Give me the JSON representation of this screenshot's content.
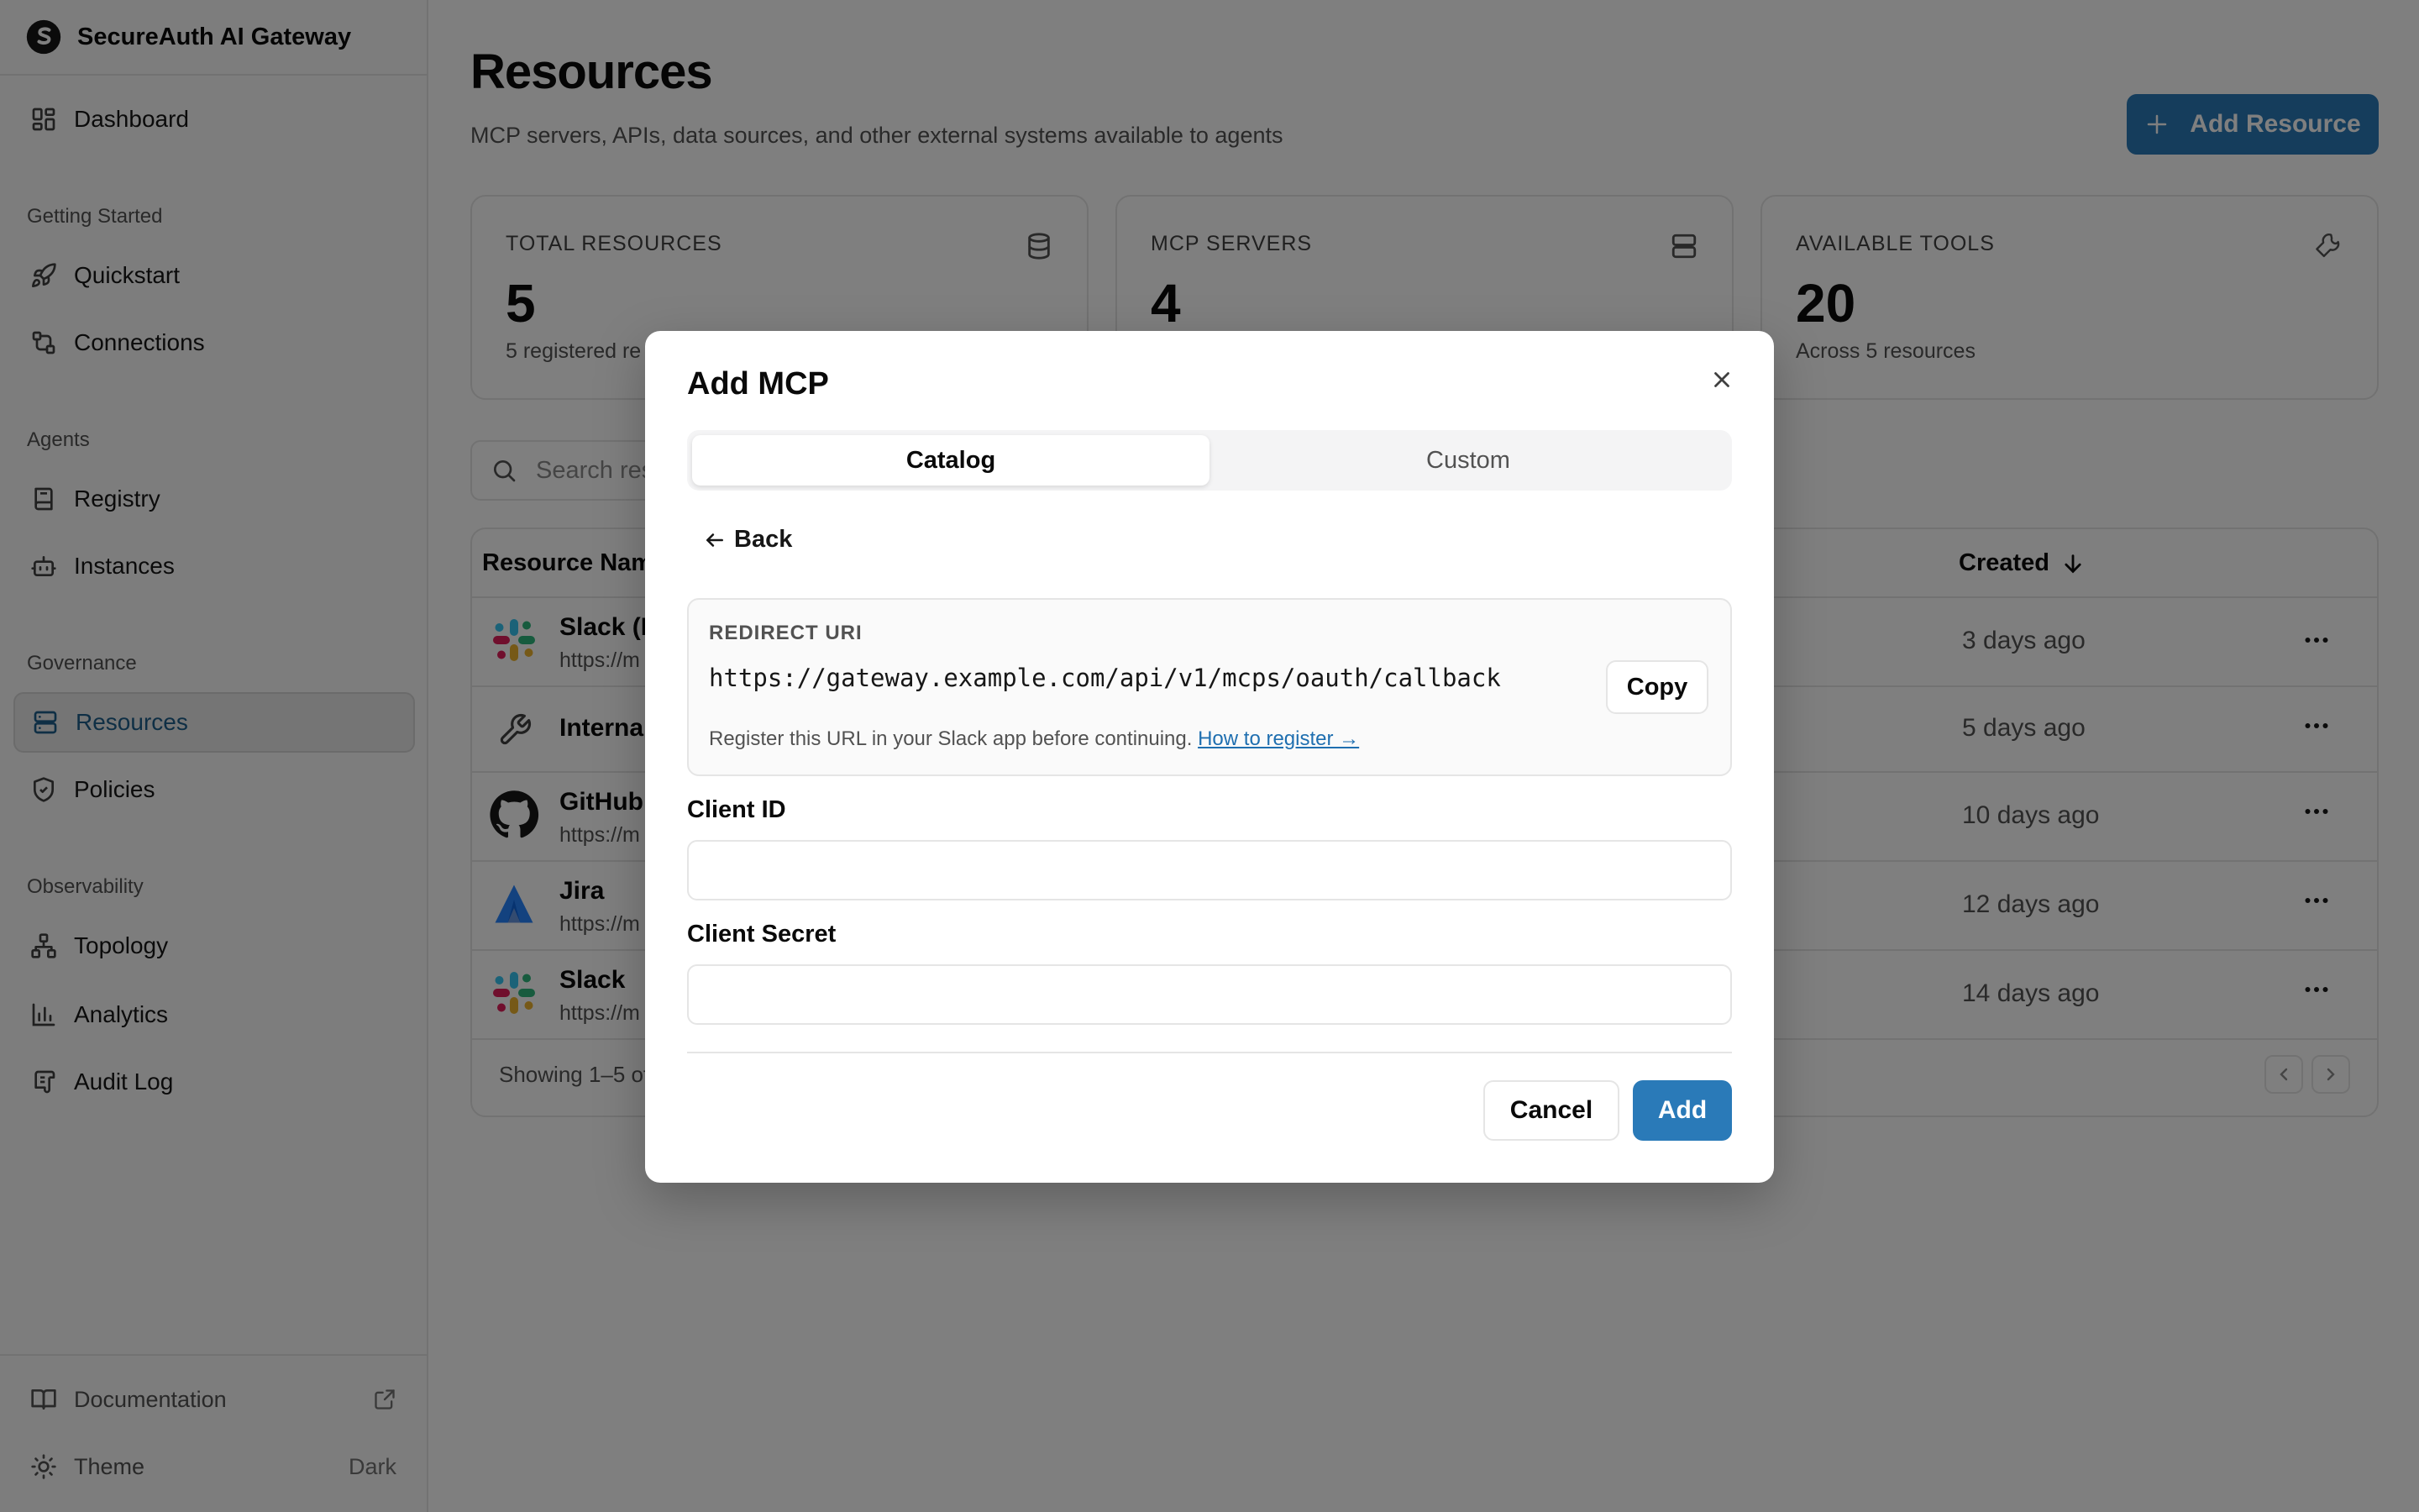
{
  "app": {
    "title": "SecureAuth AI Gateway"
  },
  "sidebar": {
    "dashboard": "Dashboard",
    "sections": {
      "getting_started": "Getting Started",
      "agents": "Agents",
      "governance": "Governance",
      "observability": "Observability"
    },
    "items": {
      "quickstart": "Quickstart",
      "connections": "Connections",
      "registry": "Registry",
      "instances": "Instances",
      "resources": "Resources",
      "policies": "Policies",
      "topology": "Topology",
      "analytics": "Analytics",
      "audit_log": "Audit Log"
    },
    "footer": {
      "documentation": "Documentation",
      "theme_label": "Theme",
      "theme_value": "Dark"
    }
  },
  "page": {
    "title": "Resources",
    "subtitle": "MCP servers, APIs, data sources, and other external systems available to agents",
    "add_button": "Add Resource"
  },
  "stats": [
    {
      "label": "TOTAL RESOURCES",
      "value": "5",
      "desc": "5 registered re"
    },
    {
      "label": "MCP SERVERS",
      "value": "4",
      "desc": ""
    },
    {
      "label": "AVAILABLE TOOLS",
      "value": "20",
      "desc": "Across 5 resources"
    }
  ],
  "search": {
    "placeholder": "Search resources..."
  },
  "table": {
    "col_name": "Resource Nam",
    "col_created": "Created",
    "rows": [
      {
        "name": "Slack (E",
        "url": "https://m",
        "created": "3 days ago"
      },
      {
        "name": "Internal",
        "url": "",
        "created": "5 days ago"
      },
      {
        "name": "GitHub",
        "url": "https://m",
        "created": "10 days ago"
      },
      {
        "name": "Jira",
        "url": "https://m",
        "created": "12 days ago"
      },
      {
        "name": "Slack",
        "url": "https://m",
        "created": "14 days ago"
      }
    ],
    "footer": "Showing 1–5 of"
  },
  "modal": {
    "title": "Add MCP",
    "tabs": [
      "Catalog",
      "Custom"
    ],
    "active_tab": "Catalog",
    "back": "Back",
    "redirect_label": "REDIRECT URI",
    "redirect_uri": "https://gateway.example.com/api/v1/mcps/oauth/callback",
    "copy": "Copy",
    "note": "Register this URL in your Slack app before continuing.",
    "note_link": "How to register →",
    "client_id_label": "Client ID",
    "client_id_value": "",
    "client_secret_label": "Client Secret",
    "client_secret_value": "",
    "cancel": "Cancel",
    "add": "Add"
  },
  "colors": {
    "accent": "#2a7ab8",
    "active_nav": "#1f5f8b"
  }
}
